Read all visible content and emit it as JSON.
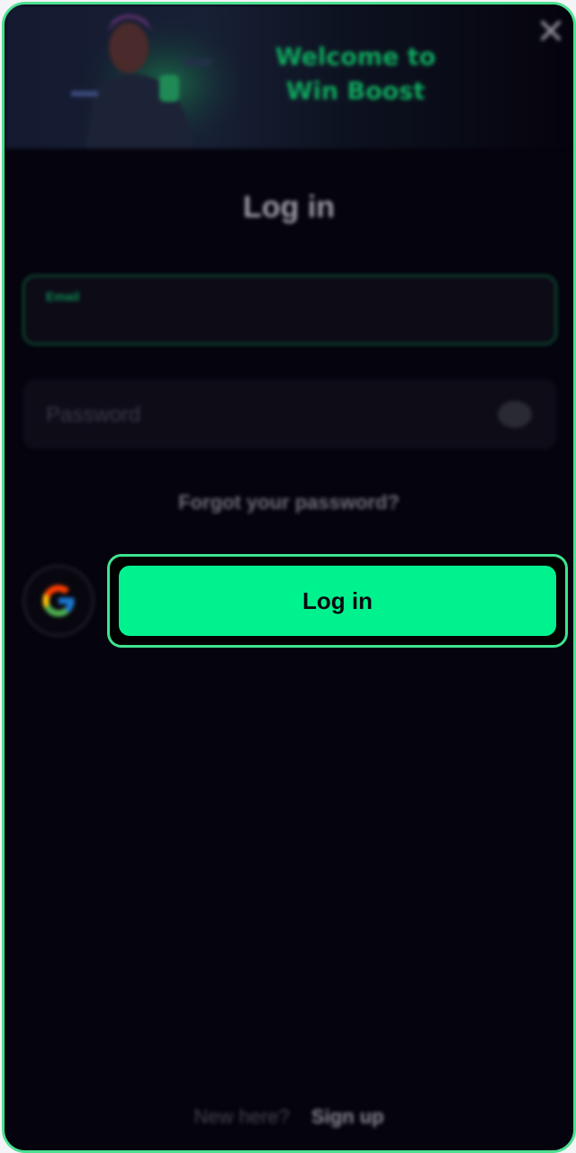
{
  "banner": {
    "title_line1": "Welcome to",
    "title_line2": "Win Boost"
  },
  "form": {
    "title": "Log in",
    "email_label": "Email",
    "password_placeholder": "Password",
    "forgot_link": "Forgot your password?",
    "login_label": "Log in"
  },
  "footer": {
    "prompt": "New here?",
    "signup_label": "Sign up"
  },
  "colors": {
    "accent": "#00f28e",
    "outline": "#4ddf92",
    "background": "#05030d"
  },
  "icons": [
    "close-icon",
    "eye-icon",
    "google-icon"
  ]
}
